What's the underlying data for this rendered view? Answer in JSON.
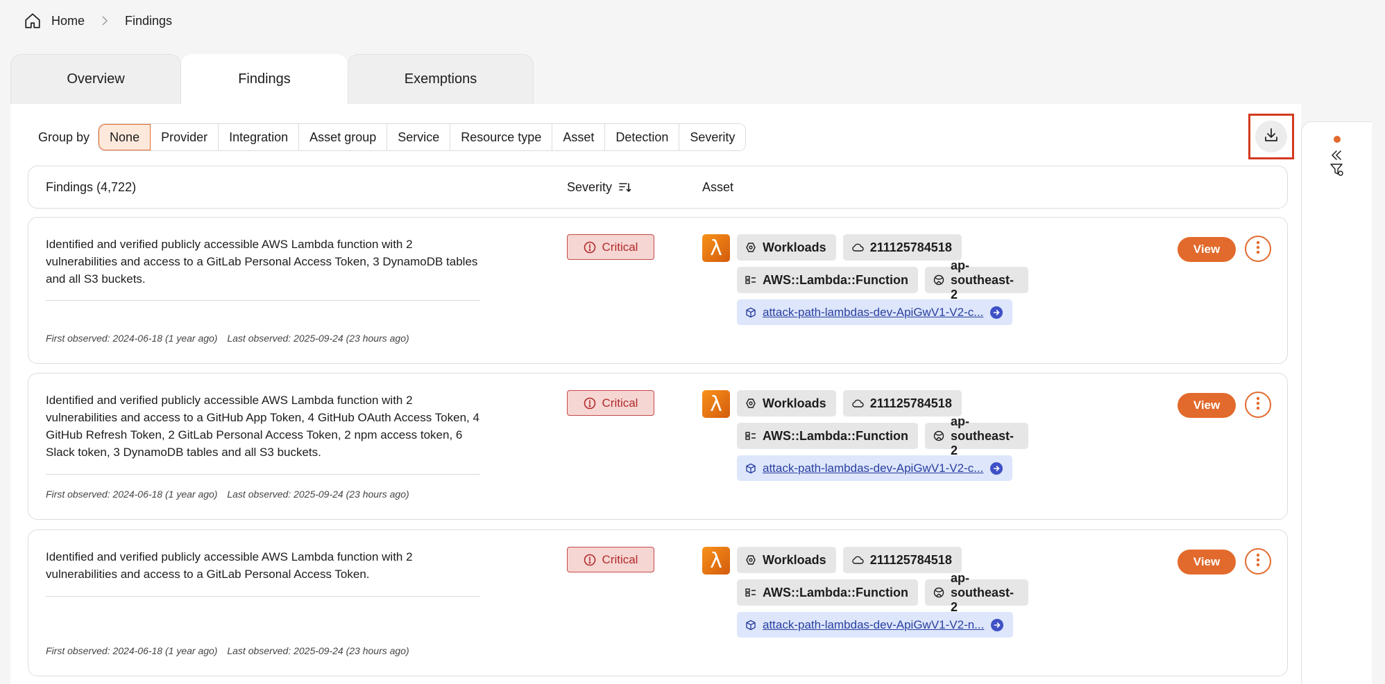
{
  "breadcrumb": {
    "home": "Home",
    "current": "Findings"
  },
  "tabs": [
    {
      "label": "Overview"
    },
    {
      "label": "Findings"
    },
    {
      "label": "Exemptions"
    }
  ],
  "group_by": {
    "label": "Group by",
    "options": [
      "None",
      "Provider",
      "Integration",
      "Asset group",
      "Service",
      "Resource type",
      "Asset",
      "Detection",
      "Severity"
    ],
    "selected": "None"
  },
  "table_header": {
    "findings": "Findings (4,722)",
    "severity": "Severity",
    "asset": "Asset"
  },
  "findings": [
    {
      "description": "Identified and verified publicly accessible AWS Lambda function with 2 vulnerabilities and access to a GitLab Personal Access Token, 3 DynamoDB tables and all S3 buckets.",
      "first_observed": "First observed: 2024-06-18 (1 year ago)",
      "last_observed": "Last observed: 2025-09-24 (23 hours ago)",
      "severity": "Critical",
      "asset_group": "Workloads",
      "account": "211125784518",
      "resource_type": "AWS::Lambda::Function",
      "region": "ap-southeast-2",
      "asset_link": "attack-path-lambdas-dev-ApiGwV1-V2-c...",
      "view_label": "View"
    },
    {
      "description": "Identified and verified publicly accessible AWS Lambda function with 2 vulnerabilities and access to a GitHub App Token, 4 GitHub OAuth Access Token, 4 GitHub Refresh Token, 2 GitLab Personal Access Token, 2 npm access token, 6 Slack token, 3 DynamoDB tables and all S3 buckets.",
      "first_observed": "First observed: 2024-06-18 (1 year ago)",
      "last_observed": "Last observed: 2025-09-24 (23 hours ago)",
      "severity": "Critical",
      "asset_group": "Workloads",
      "account": "211125784518",
      "resource_type": "AWS::Lambda::Function",
      "region": "ap-southeast-2",
      "asset_link": "attack-path-lambdas-dev-ApiGwV1-V2-c...",
      "view_label": "View"
    },
    {
      "description": "Identified and verified publicly accessible AWS Lambda function with 2 vulnerabilities and access to a GitLab Personal Access Token.",
      "first_observed": "First observed: 2024-06-18 (1 year ago)",
      "last_observed": "Last observed: 2025-09-24 (23 hours ago)",
      "severity": "Critical",
      "asset_group": "Workloads",
      "account": "211125784518",
      "resource_type": "AWS::Lambda::Function",
      "region": "ap-southeast-2",
      "asset_link": "attack-path-lambdas-dev-ApiGwV1-V2-n...",
      "view_label": "View"
    }
  ],
  "colors": {
    "accent": "#e26a2c",
    "critical_bg": "#f6d6d3",
    "critical_text": "#b02a2a",
    "highlight_box": "#d33a1f",
    "link_chip": "#dde6fb"
  },
  "icons": {
    "home": "home-icon",
    "download": "download-icon",
    "lambda": "aws-lambda-icon",
    "collapse": "double-chevron-left-icon",
    "filter": "filter-settings-icon"
  }
}
